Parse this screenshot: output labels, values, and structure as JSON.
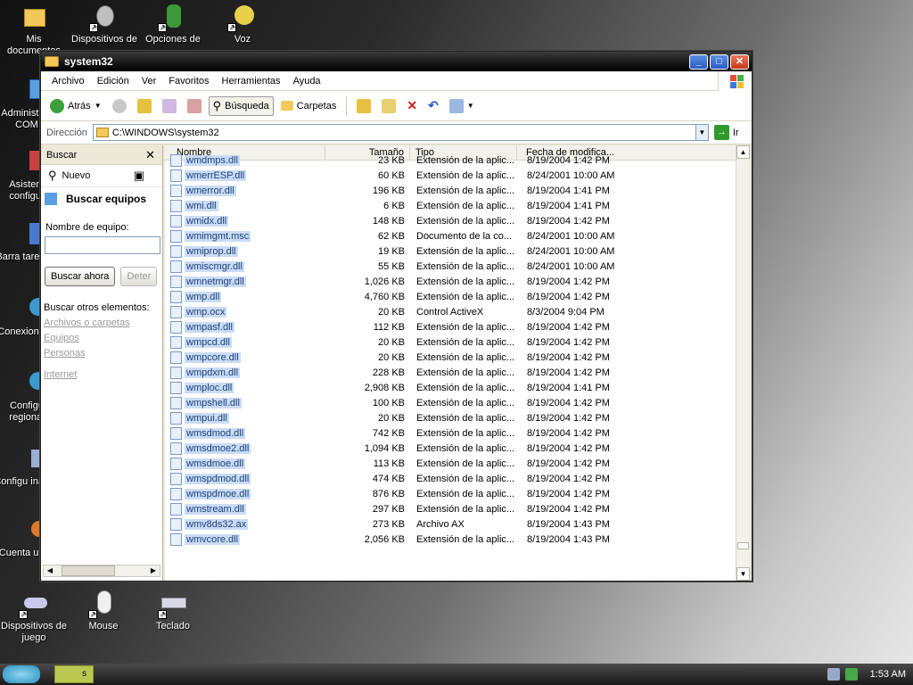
{
  "desktop": {
    "icons": [
      {
        "id": "mis-documentos",
        "label": "Mis documentos"
      },
      {
        "id": "dispositivos-sonido",
        "label": "Dispositivos de"
      },
      {
        "id": "opciones-accesibilidad",
        "label": "Opciones de"
      },
      {
        "id": "voz",
        "label": "Voz"
      },
      {
        "id": "administrador",
        "label": "Administ on COM"
      },
      {
        "id": "asistente",
        "label": "Asistent configur"
      },
      {
        "id": "barras",
        "label": "Barra tareas y"
      },
      {
        "id": "conexiones",
        "label": "Conexion red"
      },
      {
        "id": "configuracion-regional",
        "label": "Configu regional"
      },
      {
        "id": "configuracion-inalambrica",
        "label": "Configu inalám"
      },
      {
        "id": "cuentas-usuario",
        "label": "Cuenta usua"
      },
      {
        "id": "dispositivos-juego",
        "label": "Dispositivos de juego"
      },
      {
        "id": "mouse",
        "label": "Mouse"
      },
      {
        "id": "teclado",
        "label": "Teclado"
      }
    ]
  },
  "window": {
    "title": "system32",
    "menu": [
      "Archivo",
      "Edición",
      "Ver",
      "Favoritos",
      "Herramientas",
      "Ayuda"
    ],
    "toolbar": {
      "back": "Atrás",
      "search": "Búsqueda",
      "folders": "Carpetas"
    },
    "address": {
      "label": "Dirección",
      "value": "C:\\WINDOWS\\system32",
      "go": "Ir"
    }
  },
  "search_pane": {
    "header": "Buscar",
    "new": "Nuevo",
    "title": "Buscar equipos",
    "field_label": "Nombre de equipo:",
    "field_value": "",
    "search_button": "Buscar ahora",
    "stop_button": "Deter",
    "other_label": "Buscar otros elementos:",
    "links": [
      "Archivos o carpetas",
      "Equipos",
      "Personas",
      "Internet"
    ]
  },
  "file_list": {
    "columns": [
      "Nombre",
      "Tamaño",
      "Tipo",
      "Fecha de modifica..."
    ],
    "rows": [
      {
        "name": "wmdmps.dll",
        "size": "23 KB",
        "type": "Extensión de la aplic...",
        "date": "8/19/2004 1:42 PM",
        "clip": true
      },
      {
        "name": "wmerrESP.dll",
        "size": "60 KB",
        "type": "Extensión de la aplic...",
        "date": "8/24/2001 10:00 AM"
      },
      {
        "name": "wmerror.dll",
        "size": "196 KB",
        "type": "Extensión de la aplic...",
        "date": "8/19/2004 1:41 PM"
      },
      {
        "name": "wmi.dll",
        "size": "6 KB",
        "type": "Extensión de la aplic...",
        "date": "8/19/2004 1:41 PM"
      },
      {
        "name": "wmidx.dll",
        "size": "148 KB",
        "type": "Extensión de la aplic...",
        "date": "8/19/2004 1:42 PM"
      },
      {
        "name": "wmimgmt.msc",
        "size": "62 KB",
        "type": "Documento de la co...",
        "date": "8/24/2001 10:00 AM"
      },
      {
        "name": "wmiprop.dll",
        "size": "19 KB",
        "type": "Extensión de la aplic...",
        "date": "8/24/2001 10:00 AM"
      },
      {
        "name": "wmiscmgr.dll",
        "size": "55 KB",
        "type": "Extensión de la aplic...",
        "date": "8/24/2001 10:00 AM"
      },
      {
        "name": "wmnetmgr.dll",
        "size": "1,026 KB",
        "type": "Extensión de la aplic...",
        "date": "8/19/2004 1:42 PM"
      },
      {
        "name": "wmp.dll",
        "size": "4,760 KB",
        "type": "Extensión de la aplic...",
        "date": "8/19/2004 1:42 PM"
      },
      {
        "name": "wmp.ocx",
        "size": "20 KB",
        "type": "Control ActiveX",
        "date": "8/3/2004 9:04 PM"
      },
      {
        "name": "wmpasf.dll",
        "size": "112 KB",
        "type": "Extensión de la aplic...",
        "date": "8/19/2004 1:42 PM"
      },
      {
        "name": "wmpcd.dll",
        "size": "20 KB",
        "type": "Extensión de la aplic...",
        "date": "8/19/2004 1:42 PM"
      },
      {
        "name": "wmpcore.dll",
        "size": "20 KB",
        "type": "Extensión de la aplic...",
        "date": "8/19/2004 1:42 PM"
      },
      {
        "name": "wmpdxm.dll",
        "size": "228 KB",
        "type": "Extensión de la aplic...",
        "date": "8/19/2004 1:42 PM"
      },
      {
        "name": "wmploc.dll",
        "size": "2,908 KB",
        "type": "Extensión de la aplic...",
        "date": "8/19/2004 1:41 PM"
      },
      {
        "name": "wmpshell.dll",
        "size": "100 KB",
        "type": "Extensión de la aplic...",
        "date": "8/19/2004 1:42 PM"
      },
      {
        "name": "wmpui.dll",
        "size": "20 KB",
        "type": "Extensión de la aplic...",
        "date": "8/19/2004 1:42 PM"
      },
      {
        "name": "wmsdmod.dll",
        "size": "742 KB",
        "type": "Extensión de la aplic...",
        "date": "8/19/2004 1:42 PM"
      },
      {
        "name": "wmsdmoe2.dll",
        "size": "1,094 KB",
        "type": "Extensión de la aplic...",
        "date": "8/19/2004 1:42 PM"
      },
      {
        "name": "wmsdmoe.dll",
        "size": "113 KB",
        "type": "Extensión de la aplic...",
        "date": "8/19/2004 1:42 PM"
      },
      {
        "name": "wmspdmod.dll",
        "size": "474 KB",
        "type": "Extensión de la aplic...",
        "date": "8/19/2004 1:42 PM"
      },
      {
        "name": "wmspdmoe.dll",
        "size": "876 KB",
        "type": "Extensión de la aplic...",
        "date": "8/19/2004 1:42 PM"
      },
      {
        "name": "wmstream.dll",
        "size": "297 KB",
        "type": "Extensión de la aplic...",
        "date": "8/19/2004 1:42 PM"
      },
      {
        "name": "wmv8ds32.ax",
        "size": "273 KB",
        "type": "Archivo AX",
        "date": "8/19/2004 1:43 PM"
      },
      {
        "name": "wmvcore.dll",
        "size": "2,056 KB",
        "type": "Extensión de la aplic...",
        "date": "8/19/2004 1:43 PM"
      }
    ]
  },
  "taskbar": {
    "task_label": "s",
    "clock": "1:53 AM"
  }
}
